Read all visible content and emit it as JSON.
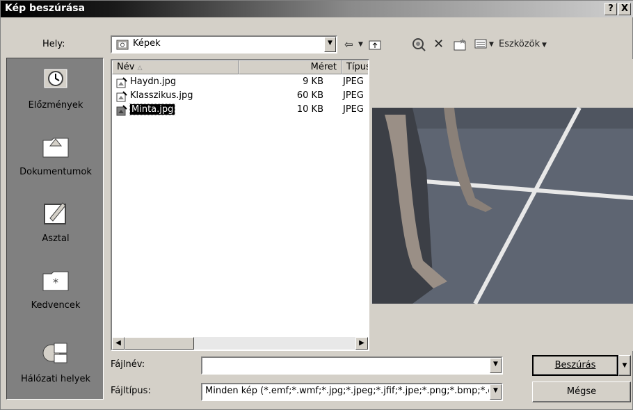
{
  "window": {
    "title": "Kép beszúrása",
    "help_label": "?",
    "close_label": "X"
  },
  "location": {
    "label": "Hely:",
    "value": "Képek"
  },
  "toolbar": {
    "back_icon": "back-arrow-icon",
    "up_icon": "up-folder-icon",
    "search_icon": "search-web-icon",
    "delete_icon": "delete-icon",
    "new_folder_icon": "new-folder-icon",
    "views_icon": "views-icon",
    "tools_label": "Eszközök"
  },
  "places": [
    {
      "label": "Előzmények",
      "icon": "history-icon"
    },
    {
      "label": "Dokumentumok",
      "icon": "documents-folder-icon"
    },
    {
      "label": "Asztal",
      "icon": "desktop-icon"
    },
    {
      "label": "Kedvencek",
      "icon": "favorites-folder-icon"
    },
    {
      "label": "Hálózati helyek",
      "icon": "network-places-icon"
    }
  ],
  "file_list": {
    "columns": {
      "name": "Név",
      "size": "Méret",
      "type": "Típus"
    },
    "rows": [
      {
        "name": "Haydn.jpg",
        "size": "9 KB",
        "type": "JPEG"
      },
      {
        "name": "Klasszikus.jpg",
        "size": "60 KB",
        "type": "JPEG"
      },
      {
        "name": "Minta.jpg",
        "size": "10 KB",
        "type": "JPEG"
      }
    ]
  },
  "filename": {
    "label": "Fájlnév:",
    "value": ""
  },
  "filetype": {
    "label": "Fájltípus:",
    "value": "Minden kép (*.emf;*.wmf;*.jpg;*.jpeg;*.jfif;*.jpe;*.png;*.bmp;*.dib;*.rle;*.gif;*.emz;*.wmz;*.pcz;*.tif;*.tiff;*.eps;*.pct;*.pict;*.wpg)"
  },
  "buttons": {
    "insert": "Beszúrás",
    "cancel": "Mégse"
  },
  "colors": {
    "selection": "#000080",
    "preview_track": "#5e6572"
  }
}
